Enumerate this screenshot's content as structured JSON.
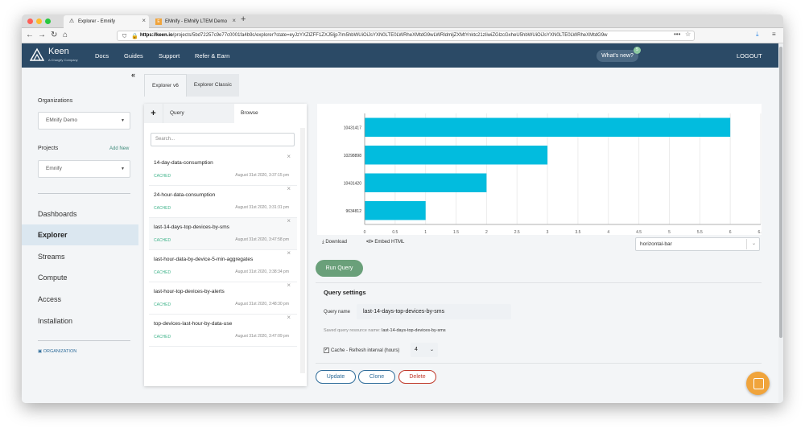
{
  "browser": {
    "tabs": [
      {
        "title": "Explorer - Emnify",
        "favicon": "warning-triangle-icon"
      },
      {
        "title": "EMnify - EMnify LTEM Demo",
        "favicon": "emnify-logo-icon"
      }
    ],
    "url_host": "https://keen.io",
    "url_path": "/projects/5bd72257c9e77c0001fa4b9c/explorer?state=eyJzYXZlZFF1ZXJ5Ijp7Im5hbWUiOiJsYXN0LTE0LWRheXMtdG9wLWRldmljZXMtYnktc21zIiwiZGlzcGxheU5hbWUiOiJsYXN0LTE0LWRheXMtdG9w"
  },
  "header": {
    "brand": "Keen",
    "brand_sub": "A Chargify Company",
    "nav": [
      "Docs",
      "Guides",
      "Support",
      "Refer & Earn"
    ],
    "whats_new": "What's new?",
    "whats_new_count": "5",
    "logout": "LOGOUT"
  },
  "sidebar": {
    "collapse": "«",
    "organizations_label": "Organizations",
    "organization_value": "EMnify Demo",
    "projects_label": "Projects",
    "add_new": "Add New",
    "project_value": "Emnify",
    "items": [
      "Dashboards",
      "Explorer",
      "Streams",
      "Compute",
      "Access",
      "Installation"
    ],
    "org_link": "ORGANIZATION"
  },
  "main": {
    "tabs": [
      "Explorer v6",
      "Explorer Classic"
    ],
    "panel_tabs": {
      "plus": "+",
      "query": "Query",
      "browse": "Browse"
    },
    "search_placeholder": "Search...",
    "queries": [
      {
        "name": "14-day-data-consumption",
        "status": "CACHED",
        "date": "August 31st 2020, 3:37:15 pm"
      },
      {
        "name": "24-hour-data-consumption",
        "status": "CACHED",
        "date": "August 31st 2020, 3:31:31 pm"
      },
      {
        "name": "last-14-days-top-devices-by-sms",
        "status": "CACHED",
        "date": "August 31st 2020, 3:47:58 pm"
      },
      {
        "name": "last-hour-data-by-device-5-min-aggregates",
        "status": "CACHED",
        "date": "August 31st 2020, 3:38:34 pm"
      },
      {
        "name": "last-hour-top-devices-by-alerts",
        "status": "CACHED",
        "date": "August 31st 2020, 3:48:30 pm"
      },
      {
        "name": "top-devices-last-hour-by-data-use",
        "status": "CACHED",
        "date": "August 31st 2020, 3:47:09 pm"
      }
    ],
    "toolbar": {
      "download": "Download",
      "embed": "Embed HTML",
      "chart_type": "horizontal-bar"
    },
    "run_query": "Run Query",
    "settings": {
      "title": "Query settings",
      "query_name_label": "Query name",
      "query_name_value": "last-14-days-top-devices-by-sms",
      "saved_label": "Saved query resource name:",
      "saved_value": "last-14-days-top-devices-by-sms",
      "cache_label": "Cache  - Refresh interval (hours)",
      "refresh_value": "4"
    },
    "buttons": {
      "update": "Update",
      "clone": "Clone",
      "delete": "Delete"
    }
  },
  "colors": {
    "bar": "#02bcde",
    "header": "#2b4a66",
    "run": "#6aa07a",
    "delete": "#c0392b"
  },
  "chart_data": {
    "type": "bar",
    "orientation": "horizontal",
    "categories": [
      "10431417",
      "10298898",
      "10431420",
      "9634812"
    ],
    "values": [
      6,
      3,
      2,
      1
    ],
    "xlim": [
      0,
      6.5
    ],
    "xticks": [
      "0",
      "0.5",
      "1",
      "1.5",
      "2",
      "2.5",
      "3",
      "3.5",
      "4",
      "4.5",
      "5",
      "5.5",
      "6",
      "6.5"
    ],
    "grid": true
  }
}
